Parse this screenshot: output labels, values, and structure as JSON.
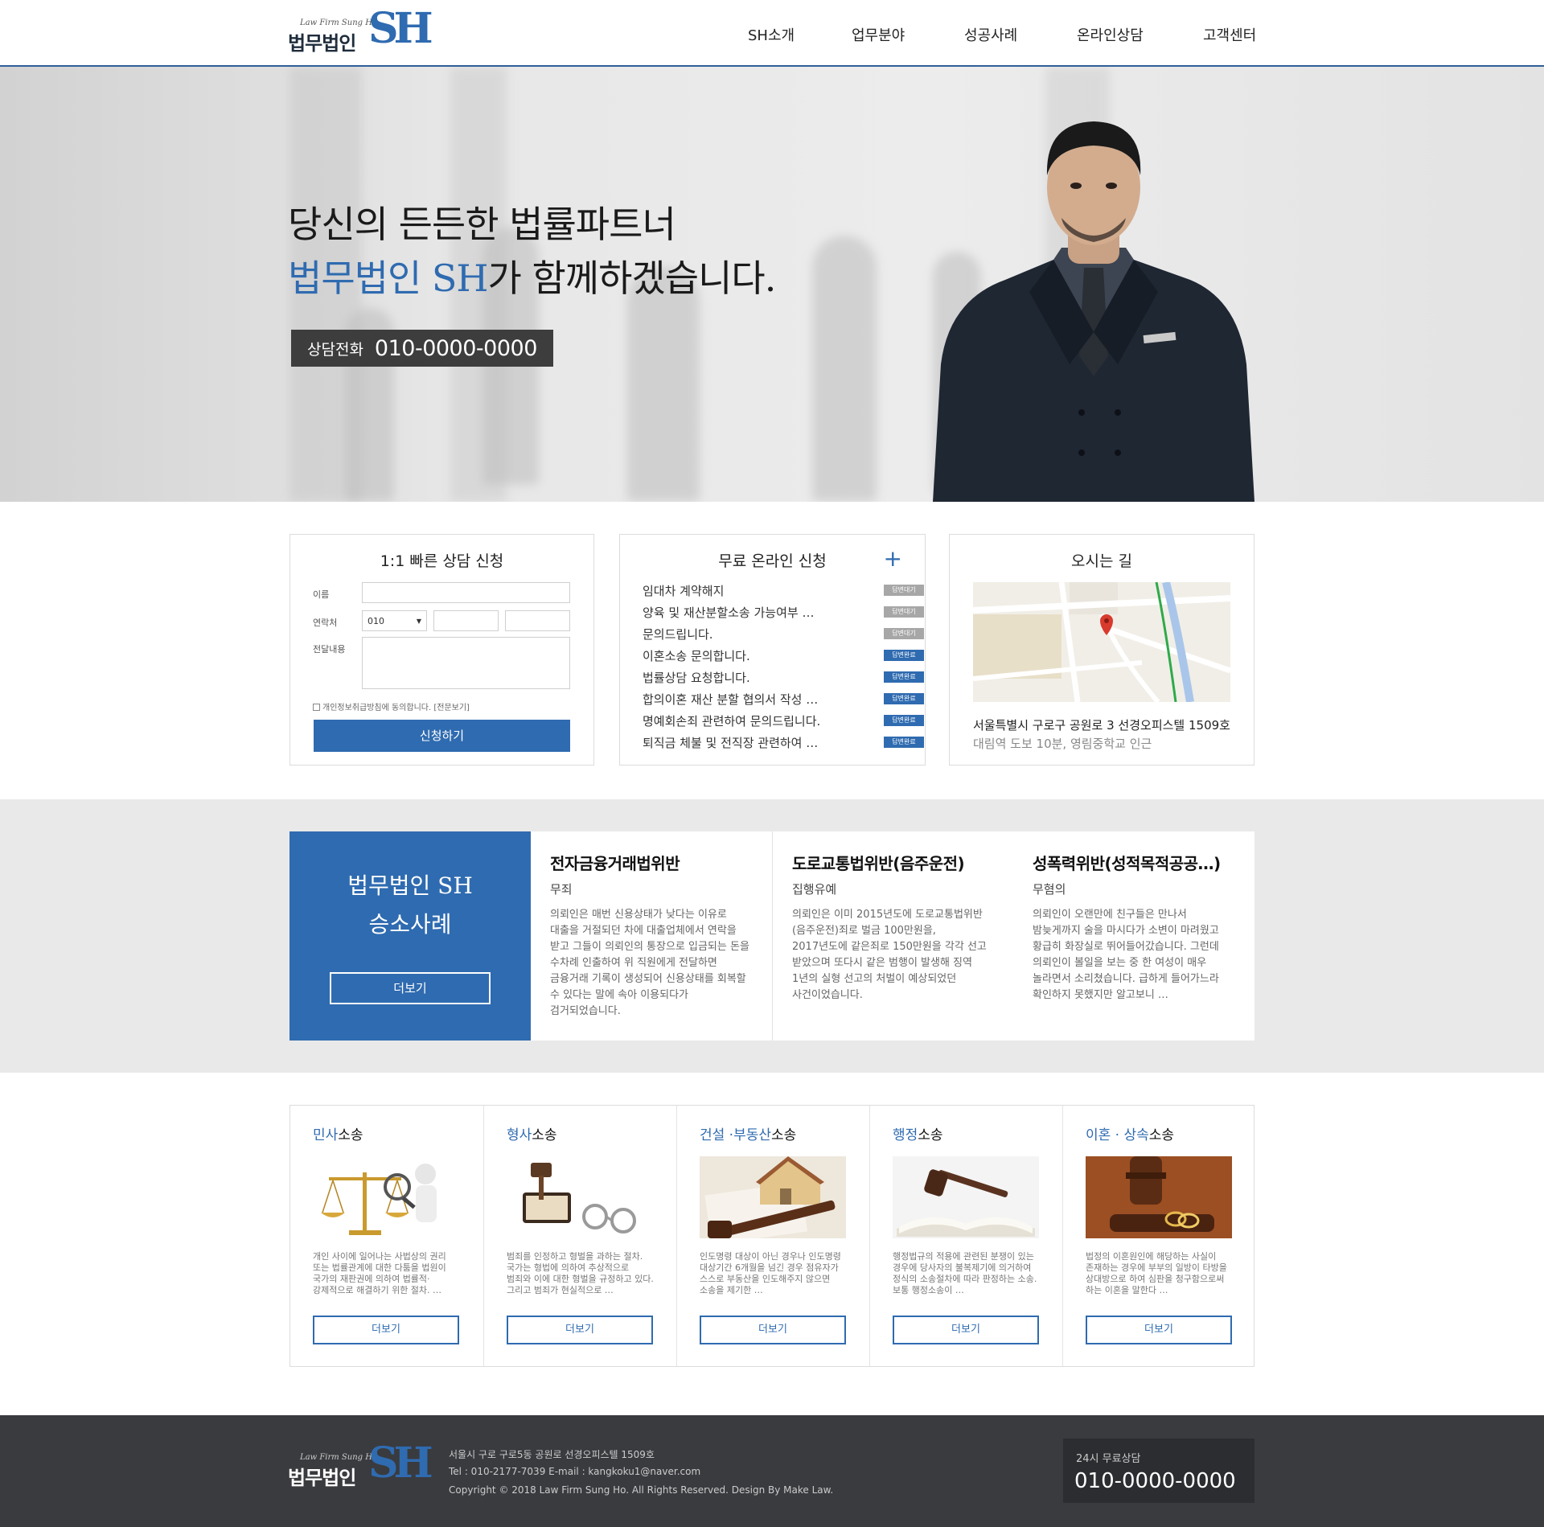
{
  "header": {
    "logo_sub": "Law Firm Sung Ho",
    "logo_name": "법무법인",
    "logo_mono": "SH",
    "nav": [
      "SH소개",
      "업무분야",
      "성공사례",
      "온라인상담",
      "고객센터"
    ]
  },
  "hero": {
    "line1": "당신의 든든한 법률파트너",
    "line2_accent": "법무법인 SH",
    "line2_rest": "가 함께하겠습니다.",
    "phone_label": "상담전화",
    "phone_number": "010-0000-0000"
  },
  "quick_form": {
    "title": "1:1 빠른 상담 신청",
    "name_label": "이름",
    "contact_label": "연락처",
    "contact_prefix": "010",
    "message_label": "전달내용",
    "agree_text": "개인정보취급방침에 동의합니다.",
    "agree_link": "[전문보기]",
    "submit": "신청하기"
  },
  "online": {
    "title": "무료 온라인 신청",
    "plus": "+",
    "items": [
      {
        "title": "임대차 계약해지",
        "status": "답변대기",
        "state": "wait"
      },
      {
        "title": "양육 및 재산분할소송 가능여부 …",
        "status": "답변대기",
        "state": "wait"
      },
      {
        "title": "문의드립니다.",
        "status": "답변대기",
        "state": "wait"
      },
      {
        "title": "이혼소송 문의합니다.",
        "status": "답변완료",
        "state": "done"
      },
      {
        "title": "법률상담 요청합니다.",
        "status": "답변완료",
        "state": "done"
      },
      {
        "title": "합의이혼 재산 분할 협의서 작성 …",
        "status": "답변완료",
        "state": "done"
      },
      {
        "title": "명예회손죄 관련하여 문의드립니다.",
        "status": "답변완료",
        "state": "done"
      },
      {
        "title": "퇴직금 체불 및 전직장 관련하여 …",
        "status": "답변완료",
        "state": "done"
      }
    ]
  },
  "directions": {
    "title": "오시는 길",
    "address": "서울특별시 구로구 공원로 3 선경오피스텔 1509호",
    "note": "대림역 도보 10분, 영림중학교 인근"
  },
  "cases": {
    "hl_line1": "법무법인 SH",
    "hl_line2": "승소사례",
    "hl_more": "더보기",
    "items": [
      {
        "title": "전자금융거래법위반",
        "verdict": "무죄",
        "desc": "의뢰인은 매번 신용상태가 낮다는 이유로 대출을 거절되던 차에 대출업체에서 연락을 받고 그들이 의뢰인의 통장으로 입금되는 돈을 수차례 인출하여 위 직원에게 전달하면 금융거래 기록이 생성되어 신용상태를 회복할 수 있다는 말에 속아 이용되다가 검거되었습니다."
      },
      {
        "title": "도로교통법위반(음주운전)",
        "verdict": "집행유예",
        "desc": "의뢰인은 이미 2015년도에 도로교통법위반(음주운전)죄로 벌금 100만원을, 2017년도에 같은죄로 150만원을 각각 선고 받았으며 또다시 같은 범행이 발생해 징역 1년의 실형 선고의 처벌이 예상되었던 사건이었습니다."
      },
      {
        "title": "성폭력위반(성적목적공공…)",
        "verdict": "무혐의",
        "desc": "의뢰인이 오랜만에 친구들은 만나서 밤늦게까지 술을 마시다가 소변이 마려웠고 황급히 화장실로 뛰어들어갔습니다. 그런데 의뢰인이 볼일을 보는 중 한 여성이 매우 놀라면서 소리쳤습니다. 급하게 들어가느라 확인하지 못했지만 알고보니 …"
      }
    ]
  },
  "areas": [
    {
      "hl": "민사",
      "rest": "소송",
      "desc": "개인 사이에 일어나는 사법상의 권리 또는 법률관계에 대한 다툼을 법원이 국가의 재판권에 의하여 법률적·강제적으로 해결하기 위한 절차. …",
      "more": "더보기"
    },
    {
      "hl": "형사",
      "rest": "소송",
      "desc": "범죄를 인정하고 형벌을 과하는 절차. 국가는 형법에 의하여 추상적으로 범죄와 이에 대한 형벌을 규정하고 있다. 그리고 범죄가 현실적으로 …",
      "more": "더보기"
    },
    {
      "hl": "건설 ·부동산",
      "rest": "소송",
      "desc": "인도명령 대상이 아닌 경우나 인도명령 대상기간 6개월을 넘긴 경우 점유자가 스스로 부동산을 인도해주지 않으면 소송을 제기한 …",
      "more": "더보기"
    },
    {
      "hl": "행정",
      "rest": "소송",
      "desc": "행정법규의 적용에 관련된 분쟁이 있는 경우에 당사자의 불복제기에 의거하여 정식의 소송절차에 따라 판정하는 소송. 보통 행정소송이 …",
      "more": "더보기"
    },
    {
      "hl": "이혼 · 상속",
      "rest": "소송",
      "desc": "법정의 이혼원인에 해당하는 사실이 존재하는 경우에 부부의 일방이 타방을 상대방으로 하여 심판을 청구함으로써 하는 이혼을 말한다 …",
      "more": "더보기"
    }
  ],
  "footer": {
    "logo_sub": "Law Firm Sung Ho",
    "logo_name": "법무법인",
    "logo_mono": "SH",
    "address": "서울시 구로 구로5동 공원로 선경오피스텔 1509호",
    "contact": "Tel : 010-2177-7039    E-mail : kangkoku1@naver.com",
    "copyright": "Copyright © 2018 Law Firm Sung Ho. All Rights Reserved. Design By Make Law.",
    "call_label": "24시 무료상담",
    "call_number": "010-0000-0000"
  },
  "colors": {
    "accent": "#2f6bb0",
    "footer_bg": "#3a3b3f",
    "band_bg": "#e9e9e9",
    "badge_wait": "#a7a7a7"
  }
}
